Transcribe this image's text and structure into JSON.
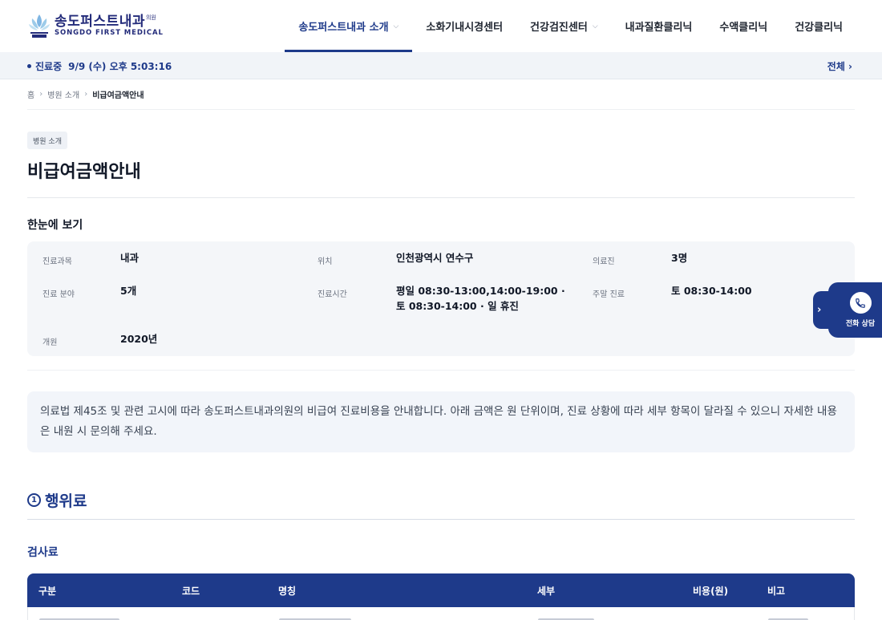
{
  "header": {
    "logo_ko": "송도퍼스트내과",
    "logo_sup": "의원",
    "logo_en": "SONGDO FIRST MEDICAL",
    "nav": [
      {
        "label": "송도퍼스트내과 소개",
        "dropdown": true,
        "active": true
      },
      {
        "label": "소화기내시경센터",
        "dropdown": false
      },
      {
        "label": "건강검진센터",
        "dropdown": true
      },
      {
        "label": "내과질환클리닉",
        "dropdown": false
      },
      {
        "label": "수액클리닉",
        "dropdown": false
      },
      {
        "label": "건강클리닉",
        "dropdown": false
      }
    ]
  },
  "status": {
    "label": "진료중",
    "datetime": "9/9 (수) 오후 5:03:16",
    "all_link": "전체 ›"
  },
  "breadcrumb": [
    "홈",
    "병원 소개",
    "비급여금액안내"
  ],
  "page": {
    "tag": "병원 소개",
    "title": "비급여금액안내",
    "summary_heading": "한눈에 보기"
  },
  "info": {
    "dept_label": "진료과목",
    "dept_value": "내과",
    "location_label": "위치",
    "location_value": "인천광역시 연수구",
    "staff_label": "의료진",
    "staff_value": "3명",
    "fields_label": "진료 분야",
    "fields_value": "5개",
    "hours_label": "진료시간",
    "hours_value": "평일 08:30-13:00,14:00-19:00 · 토 08:30-14:00 · 일 휴진",
    "weekend_label": "주말 진료",
    "weekend_value": "토 08:30-14:00",
    "opened_label": "개원",
    "opened_value": "2020년"
  },
  "notice": "의료법 제45조 및 관련 고시에 따라 송도퍼스트내과의원의 비급여 진료비용을 안내합니다. 아래 금액은 원 단위이며, 진료 상황에 따라 세부 항목이 달라질 수 있으니 자세한 내용은 내원 시 문의해 주세요.",
  "section": {
    "number": "1",
    "title": "행위료",
    "subtitle": "검사료"
  },
  "table": {
    "headers": [
      "구분",
      "코드",
      "명칭",
      "세부",
      "비용(원)",
      "비고"
    ]
  },
  "float": {
    "call_label": "전화 상담",
    "icon": "phone-icon"
  },
  "colors": {
    "primary": "#1e3a8a",
    "panel_bg": "#f4f6f9"
  }
}
